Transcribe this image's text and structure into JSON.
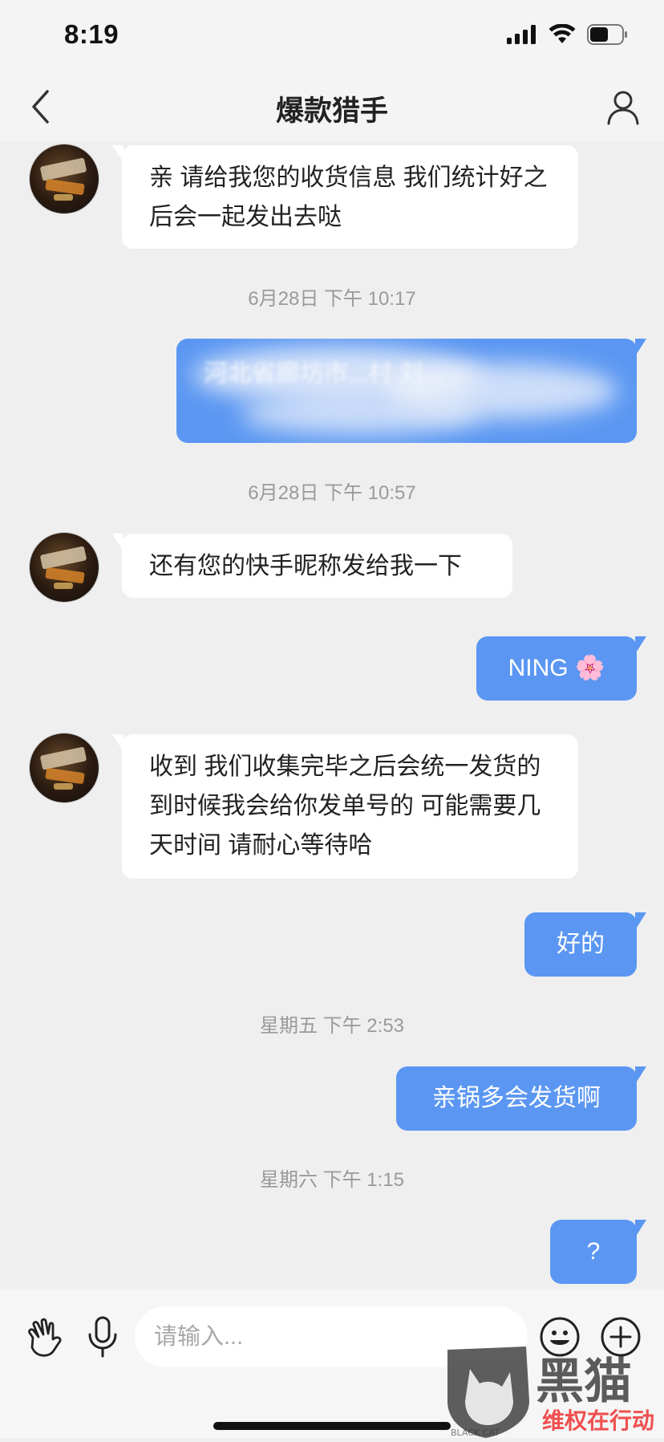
{
  "status_bar": {
    "time": "8:19"
  },
  "header": {
    "title": "爆款猎手"
  },
  "messages": [
    {
      "text": "亲  请给我您的收货信息  我们统计好之后会一起发出去哒"
    },
    {
      "timestamp": "6月28日 下午 10:17"
    },
    {
      "text": "河北省廊坊市...村 刘..."
    },
    {
      "timestamp": "6月28日 下午 10:57"
    },
    {
      "text": "还有您的快手昵称发给我一下"
    },
    {
      "text": "NING 🌸"
    },
    {
      "text": "收到  我们收集完毕之后会统一发货的  到时候我会给你发单号的  可能需要几天时间  请耐心等待哈"
    },
    {
      "text": "好的"
    },
    {
      "timestamp": "星期五 下午 2:53"
    },
    {
      "text": "亲锅多会发货啊"
    },
    {
      "timestamp": "星期六 下午 1:15"
    },
    {
      "text": "?"
    }
  ],
  "input_bar": {
    "placeholder": "请输入..."
  },
  "watermark": {
    "text_main": "黑猫",
    "text_sub": "维权在行动",
    "text_small": "BLACK CAT"
  },
  "colors": {
    "outgoing_bubble": "#5b97f2",
    "incoming_bubble": "#ffffff",
    "background": "#efeff0"
  },
  "icons": [
    "signal-icon",
    "wifi-icon",
    "battery-icon",
    "back-chevron-icon",
    "profile-icon",
    "hand-wave-icon",
    "microphone-icon",
    "emoji-icon",
    "plus-icon"
  ]
}
